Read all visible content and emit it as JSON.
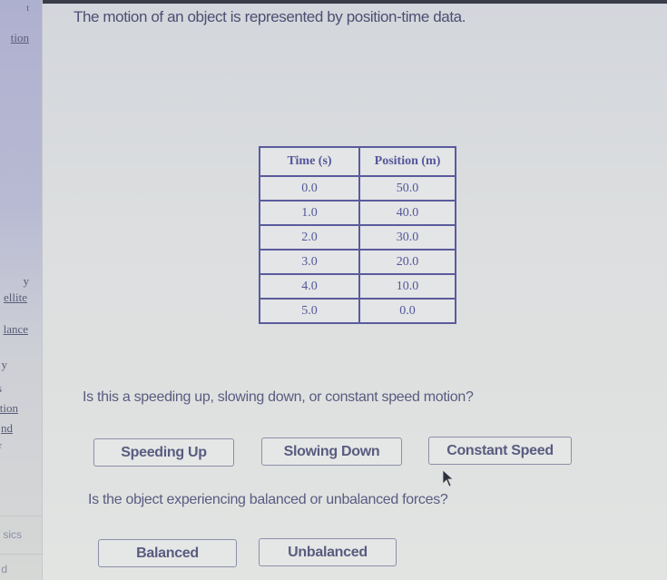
{
  "sidebar": {
    "items": [
      {
        "label": "t"
      },
      {
        "label": "tion"
      },
      {
        "label": "y"
      },
      {
        "label": "ellite"
      },
      {
        "label": "lance"
      },
      {
        "label": "y"
      },
      {
        "label": "s"
      },
      {
        "label": "tion"
      },
      {
        "label": "nd"
      },
      {
        "label": "r"
      },
      {
        "label": "sics"
      },
      {
        "label": "d"
      }
    ]
  },
  "main": {
    "prompt": "The motion of an object is represented by position-time data.",
    "table": {
      "headers": [
        "Time (s)",
        "Position (m)"
      ],
      "rows": [
        [
          "0.0",
          "50.0"
        ],
        [
          "1.0",
          "40.0"
        ],
        [
          "2.0",
          "30.0"
        ],
        [
          "3.0",
          "20.0"
        ],
        [
          "4.0",
          "10.0"
        ],
        [
          "5.0",
          "0.0"
        ]
      ]
    },
    "question1": {
      "text": "Is this a speeding up, slowing down, or constant speed motion?",
      "options": [
        "Speeding Up",
        "Slowing Down",
        "Constant Speed"
      ]
    },
    "question2": {
      "text": "Is the object experiencing balanced or unbalanced forces?",
      "options": [
        "Balanced",
        "Unbalanced"
      ]
    }
  }
}
